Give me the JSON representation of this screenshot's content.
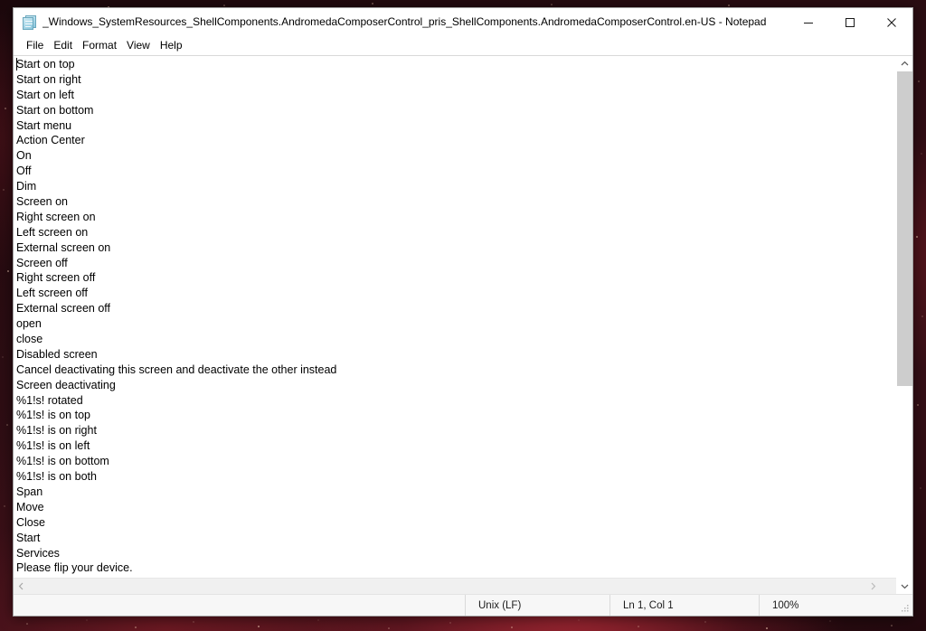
{
  "window": {
    "title": "_Windows_SystemResources_ShellComponents.AndromedaComposerControl_pris_ShellComponents.AndromedaComposerControl.en-US - Notepad",
    "app_icon": "notepad-icon",
    "controls": {
      "minimize": "Minimize",
      "maximize": "Maximize",
      "close": "Close"
    }
  },
  "menu": {
    "items": [
      {
        "label": "File"
      },
      {
        "label": "Edit"
      },
      {
        "label": "Format"
      },
      {
        "label": "View"
      },
      {
        "label": "Help"
      }
    ]
  },
  "editor": {
    "lines": [
      "Start on top",
      "Start on right",
      "Start on left",
      "Start on bottom",
      "Start menu",
      "Action Center",
      "On",
      "Off",
      "Dim",
      "Screen on",
      "Right screen on",
      "Left screen on",
      "External screen on",
      "Screen off",
      "Right screen off",
      "Left screen off",
      "External screen off",
      "open",
      "close",
      "Disabled screen",
      "Cancel deactivating this screen and deactivate the other instead",
      "Screen deactivating",
      "%1!s! rotated",
      "%1!s! is on top",
      "%1!s! is on right",
      "%1!s! is on left",
      "%1!s! is on bottom",
      "%1!s! is on both",
      "Span",
      "Move",
      "Close",
      "Start",
      "Services",
      "Please flip your device."
    ]
  },
  "scrollbars": {
    "vertical": {
      "up_arrow": "scroll-up-icon",
      "down_arrow": "scroll-down-icon",
      "thumb_top_percent": 0,
      "thumb_height_percent": 62
    },
    "horizontal": {
      "left_arrow": "scroll-left-icon",
      "right_arrow": "scroll-right-icon"
    }
  },
  "status_bar": {
    "encoding": "Unix (LF)",
    "position": "Ln 1, Col 1",
    "zoom": "100%"
  },
  "colors": {
    "window_bg": "#ffffff",
    "text": "#000000",
    "status_bg": "#f7f7f7",
    "scroll_thumb": "#cdcdcd",
    "desktop": "#2d0d13"
  }
}
